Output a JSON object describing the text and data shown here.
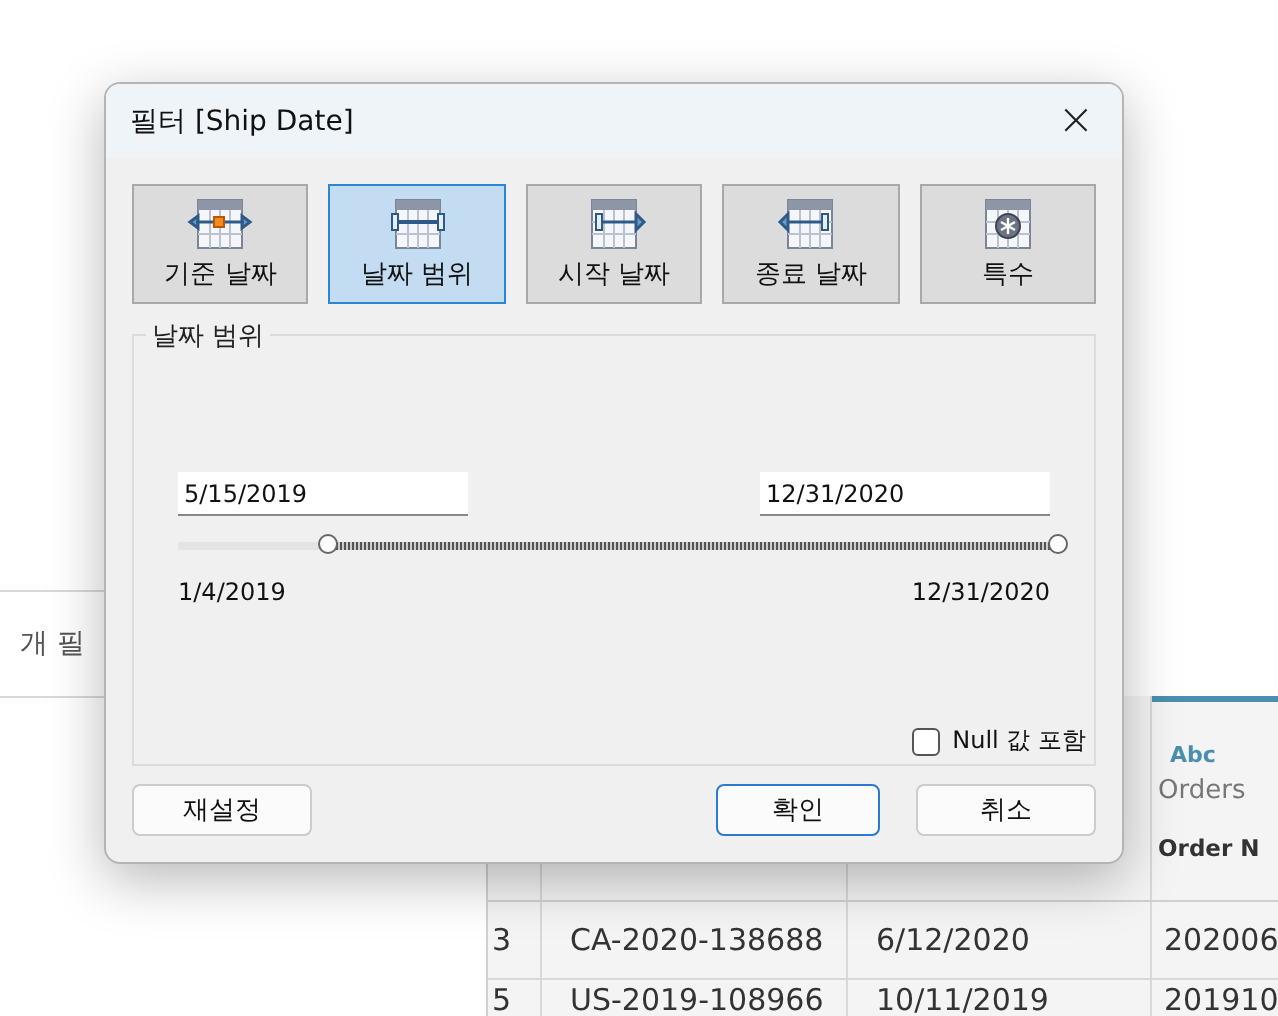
{
  "background": {
    "left_panel": {
      "label": "개 필"
    },
    "table": {
      "header": {
        "type_badge": "Abc",
        "source": "Orders",
        "column": "Order N"
      },
      "rows": [
        {
          "index": "3",
          "id": "CA-2020-138688",
          "date": "6/12/2020",
          "number": "202006"
        },
        {
          "index": "5",
          "id": "US-2019-108966",
          "date": "10/11/2019",
          "number": "201910"
        }
      ]
    }
  },
  "dialog": {
    "title": "필터 [Ship Date]",
    "close": "×",
    "modes": [
      {
        "kind": "relative",
        "label": "기준 날짜",
        "selected": false
      },
      {
        "kind": "range",
        "label": "날짜 범위",
        "selected": true
      },
      {
        "kind": "start",
        "label": "시작 날짜",
        "selected": false
      },
      {
        "kind": "end",
        "label": "종료 날짜",
        "selected": false
      },
      {
        "kind": "special",
        "label": "특수",
        "selected": false
      }
    ],
    "group": {
      "title": "날짜 범위",
      "start_value": "5/15/2019",
      "end_value": "12/31/2020",
      "slider": {
        "low": {
          "level": 0.17
        },
        "high": {
          "level": 1.0
        }
      },
      "min_label": "1/4/2019",
      "max_label": "12/31/2020",
      "include_null": {
        "label": "Null 값 포함",
        "checked": false
      }
    },
    "buttons": [
      {
        "kind": "reset",
        "label": "재설정"
      },
      {
        "kind": "ok",
        "label": "확인"
      },
      {
        "kind": "cancel",
        "label": "취소"
      }
    ]
  }
}
